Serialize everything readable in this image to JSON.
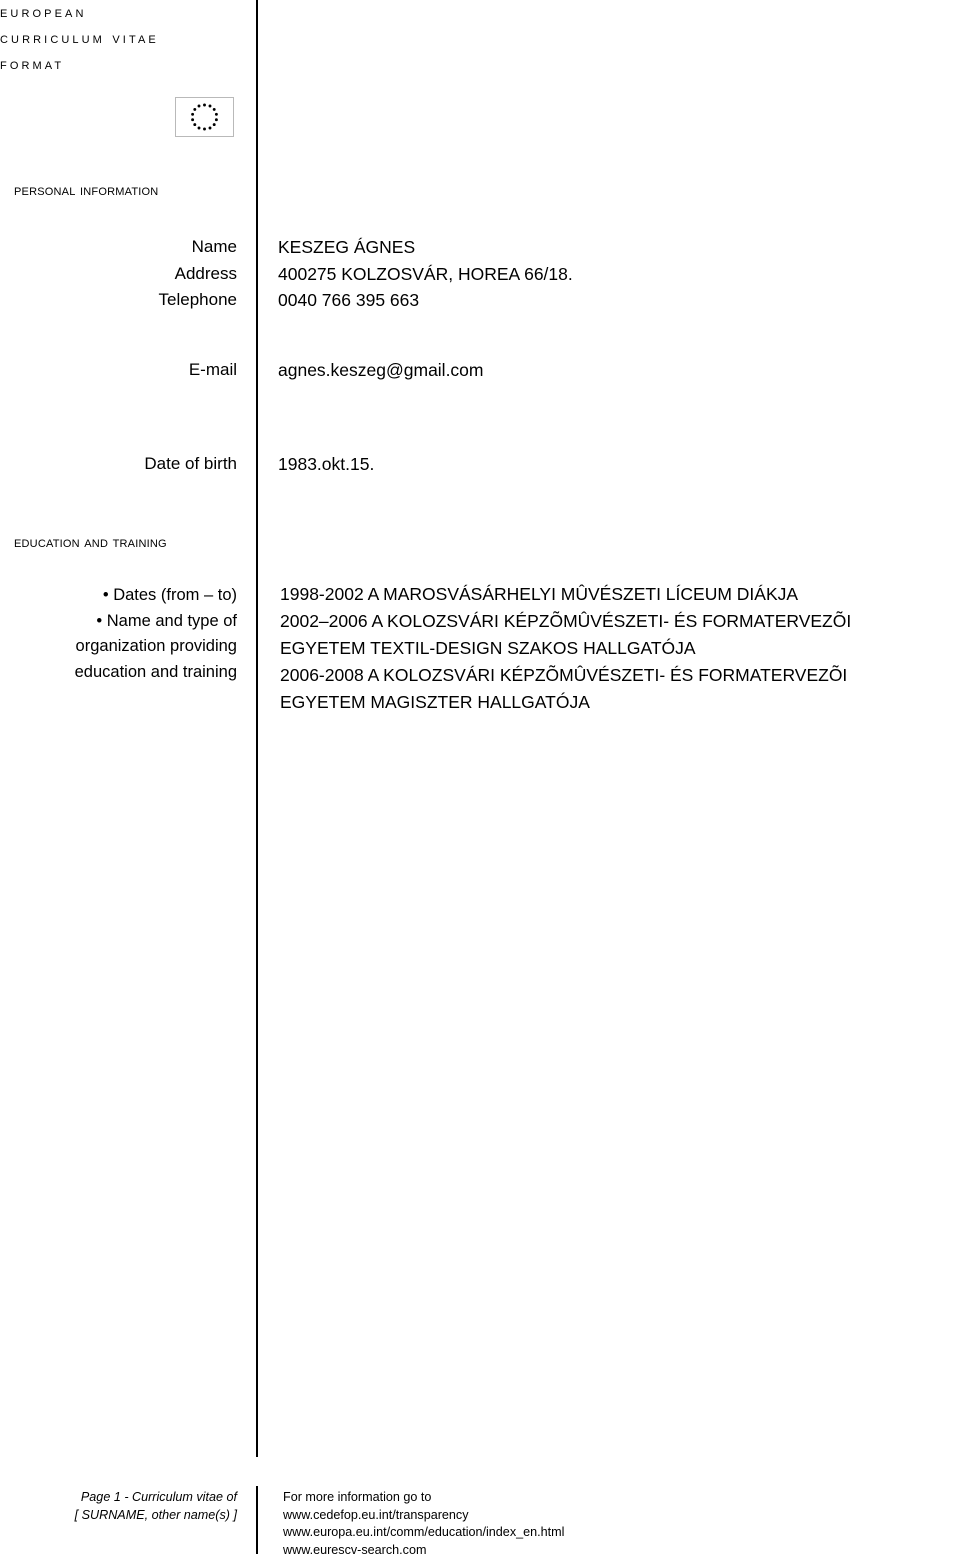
{
  "document": {
    "masthead": {
      "line1": "European",
      "line2": "Curriculum vitae",
      "line3": "format",
      "logo_name": "eu-flag-logo"
    },
    "sections": [
      {
        "heading": "Personal information",
        "fields": [
          {
            "label": "Name",
            "value": "KESZEG ÁGNES"
          },
          {
            "label": "Address",
            "value": " 400275 KOLZOSVÁR, HOREA 66/18."
          },
          {
            "label": "Telephone",
            "value": "0040 766 395 663"
          },
          {
            "label": "E-mail",
            "value": "agnes.keszeg@gmail.com"
          },
          {
            "label": "Date of birth",
            "value": "1983.okt.15."
          }
        ]
      },
      {
        "heading": "Education and training",
        "label_lines": [
          "• Dates (from – to)",
          "• Name and type of",
          "organization providing",
          "education and training"
        ],
        "value_lines": [
          "1998-2002  A MAROSVÁSÁRHELYI MÛVÉSZETI LÍCEUM DIÁKJA",
          "2002–2006 A KOLOZSVÁRI KÉPZÕMÛVÉSZETI- ÉS FORMATERVEZÕI",
          "EGYETEM TEXTIL-DESIGN SZAKOS HALLGATÓJA",
          "2006-2008 A KOLOZSVÁRI KÉPZÕMÛVÉSZETI- ÉS FORMATERVEZÕI",
          "EGYETEM MAGISZTER HALLGATÓJA"
        ]
      }
    ],
    "footer": {
      "left_line1": "Page 1 - Curriculum vitae of",
      "left_line2": "[ SURNAME, other name(s) ]",
      "right_line1": "For more information go to",
      "right_line2": "www.cedefop.eu.int/transparency",
      "right_line3": "www.europa.eu.int/comm/education/index_en.html",
      "right_line4": "www.eurescv-search.com"
    },
    "colors": {
      "text": "#000000",
      "rule": "#000000",
      "flag_border": "#b9b9b9",
      "background": "#ffffff"
    }
  }
}
